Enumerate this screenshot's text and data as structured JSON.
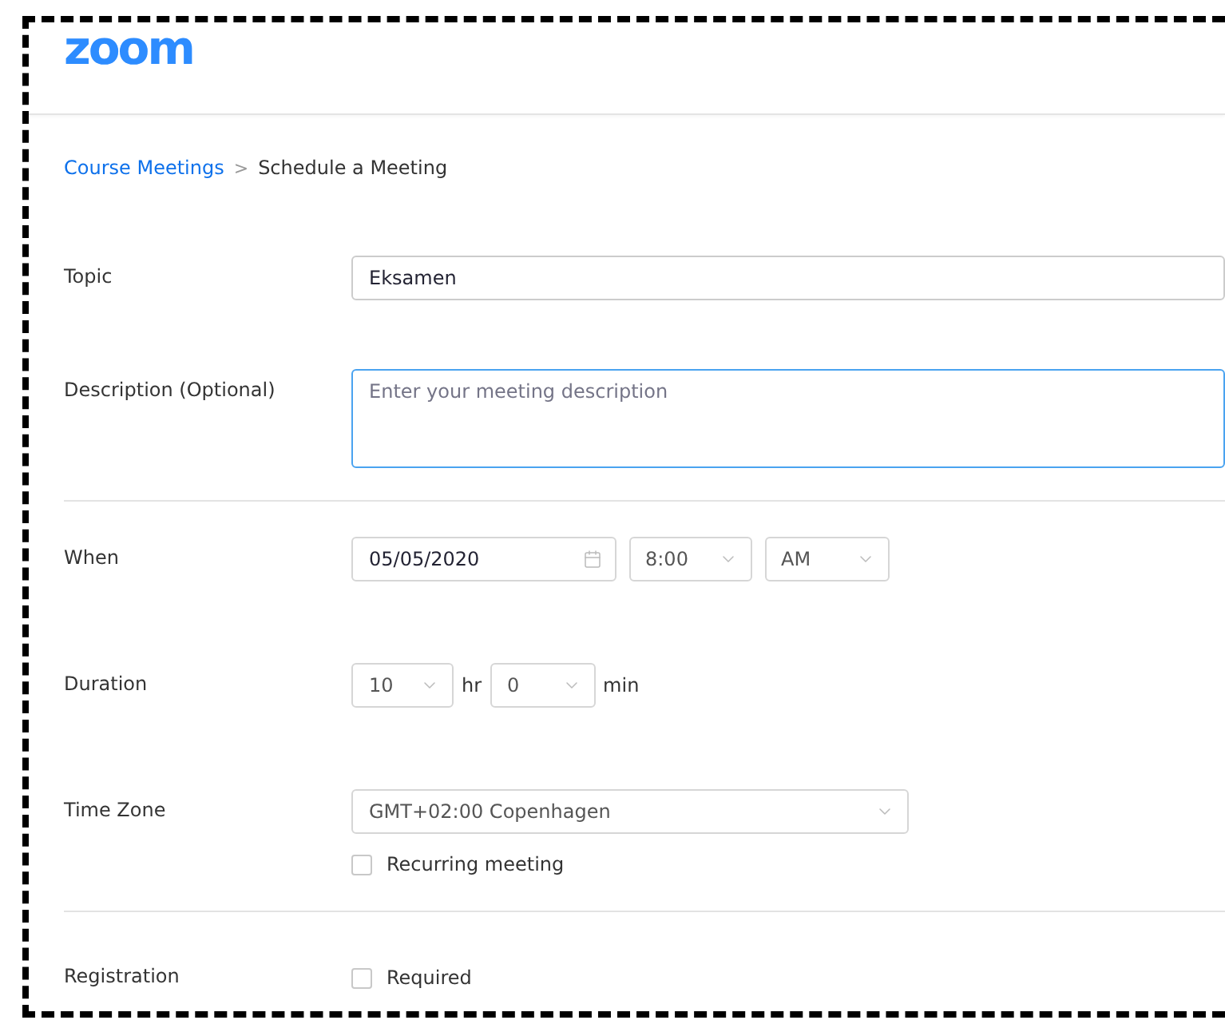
{
  "header": {
    "logo": "zoom"
  },
  "breadcrumb": {
    "parent": "Course Meetings",
    "separator": ">",
    "current": "Schedule a Meeting"
  },
  "sections": [
    {
      "rows": [
        {
          "kind": "text",
          "label": "Topic",
          "value": "Eksamen"
        },
        {
          "kind": "textarea",
          "label": "Description (Optional)",
          "placeholder": "Enter your meeting description",
          "focused": true
        }
      ]
    },
    {
      "rows": [
        {
          "kind": "datetime",
          "label": "When",
          "date": "05/05/2020",
          "time": "8:00",
          "meridiem": "AM"
        },
        {
          "kind": "duration",
          "label": "Duration",
          "hours": "10",
          "hours_unit": "hr",
          "minutes": "0",
          "minutes_unit": "min"
        },
        {
          "kind": "timezone",
          "label": "Time Zone",
          "value": "GMT+02:00 Copenhagen",
          "checkbox": {
            "label": "Recurring meeting",
            "checked": false
          }
        }
      ]
    },
    {
      "rows": [
        {
          "kind": "checkbox",
          "label": "Registration",
          "checkbox": {
            "label": "Required",
            "checked": false
          }
        }
      ]
    }
  ]
}
